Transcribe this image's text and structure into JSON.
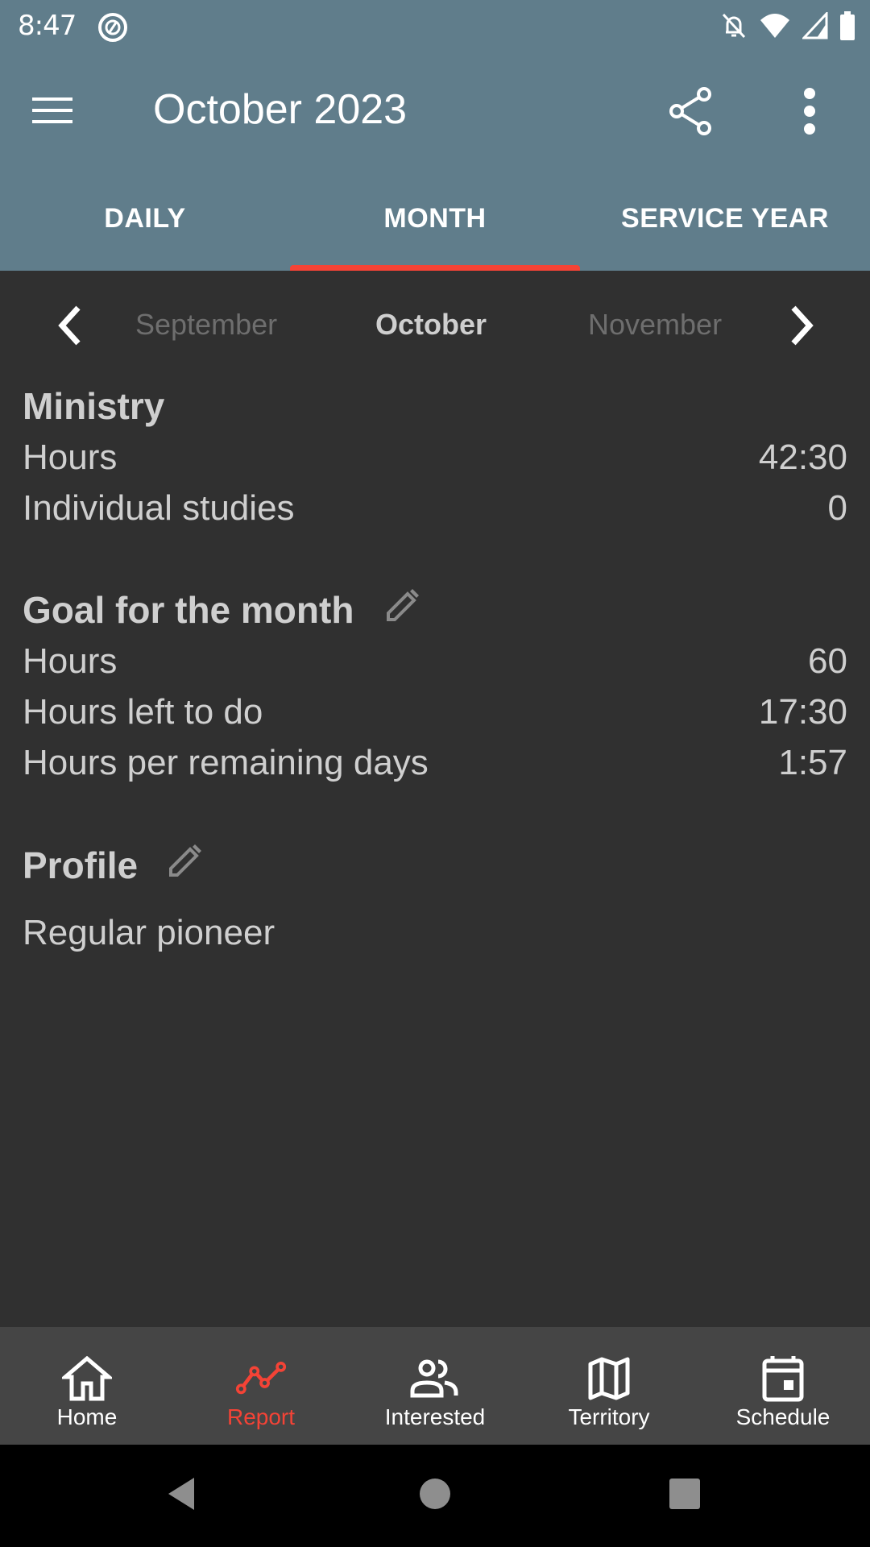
{
  "status_bar": {
    "time": "8:47",
    "icons": [
      "app-notification-icon",
      "notifications-off-icon",
      "wifi-icon",
      "signal-icon",
      "battery-icon"
    ]
  },
  "toolbar": {
    "title": "October 2023",
    "menu_icon": "hamburger-menu-icon",
    "share_icon": "share-icon",
    "overflow_icon": "more-vert-icon"
  },
  "tabs": [
    {
      "label": "DAILY",
      "active": false
    },
    {
      "label": "MONTH",
      "active": true
    },
    {
      "label": "SERVICE YEAR",
      "active": false
    }
  ],
  "month_nav": {
    "previous": "September",
    "current": "October",
    "next": "November"
  },
  "ministry": {
    "title": "Ministry",
    "rows": [
      {
        "label": "Hours",
        "value": "42:30"
      },
      {
        "label": "Individual studies",
        "value": "0"
      }
    ]
  },
  "goal": {
    "title": "Goal for the month",
    "rows": [
      {
        "label": "Hours",
        "value": "60"
      },
      {
        "label": "Hours left to do",
        "value": "17:30"
      },
      {
        "label": "Hours per remaining days",
        "value": "1:57"
      }
    ]
  },
  "profile": {
    "title": "Profile",
    "value": "Regular pioneer"
  },
  "bottom_nav": [
    {
      "label": "Home",
      "icon": "home-icon",
      "active": false
    },
    {
      "label": "Report",
      "icon": "report-chart-icon",
      "active": true
    },
    {
      "label": "Interested",
      "icon": "people-icon",
      "active": false
    },
    {
      "label": "Territory",
      "icon": "map-icon",
      "active": false
    },
    {
      "label": "Schedule",
      "icon": "calendar-icon",
      "active": false
    }
  ],
  "colors": {
    "primary": "#607d8b",
    "accent": "#f44336",
    "background": "#303030",
    "bottom_nav": "#454545"
  }
}
